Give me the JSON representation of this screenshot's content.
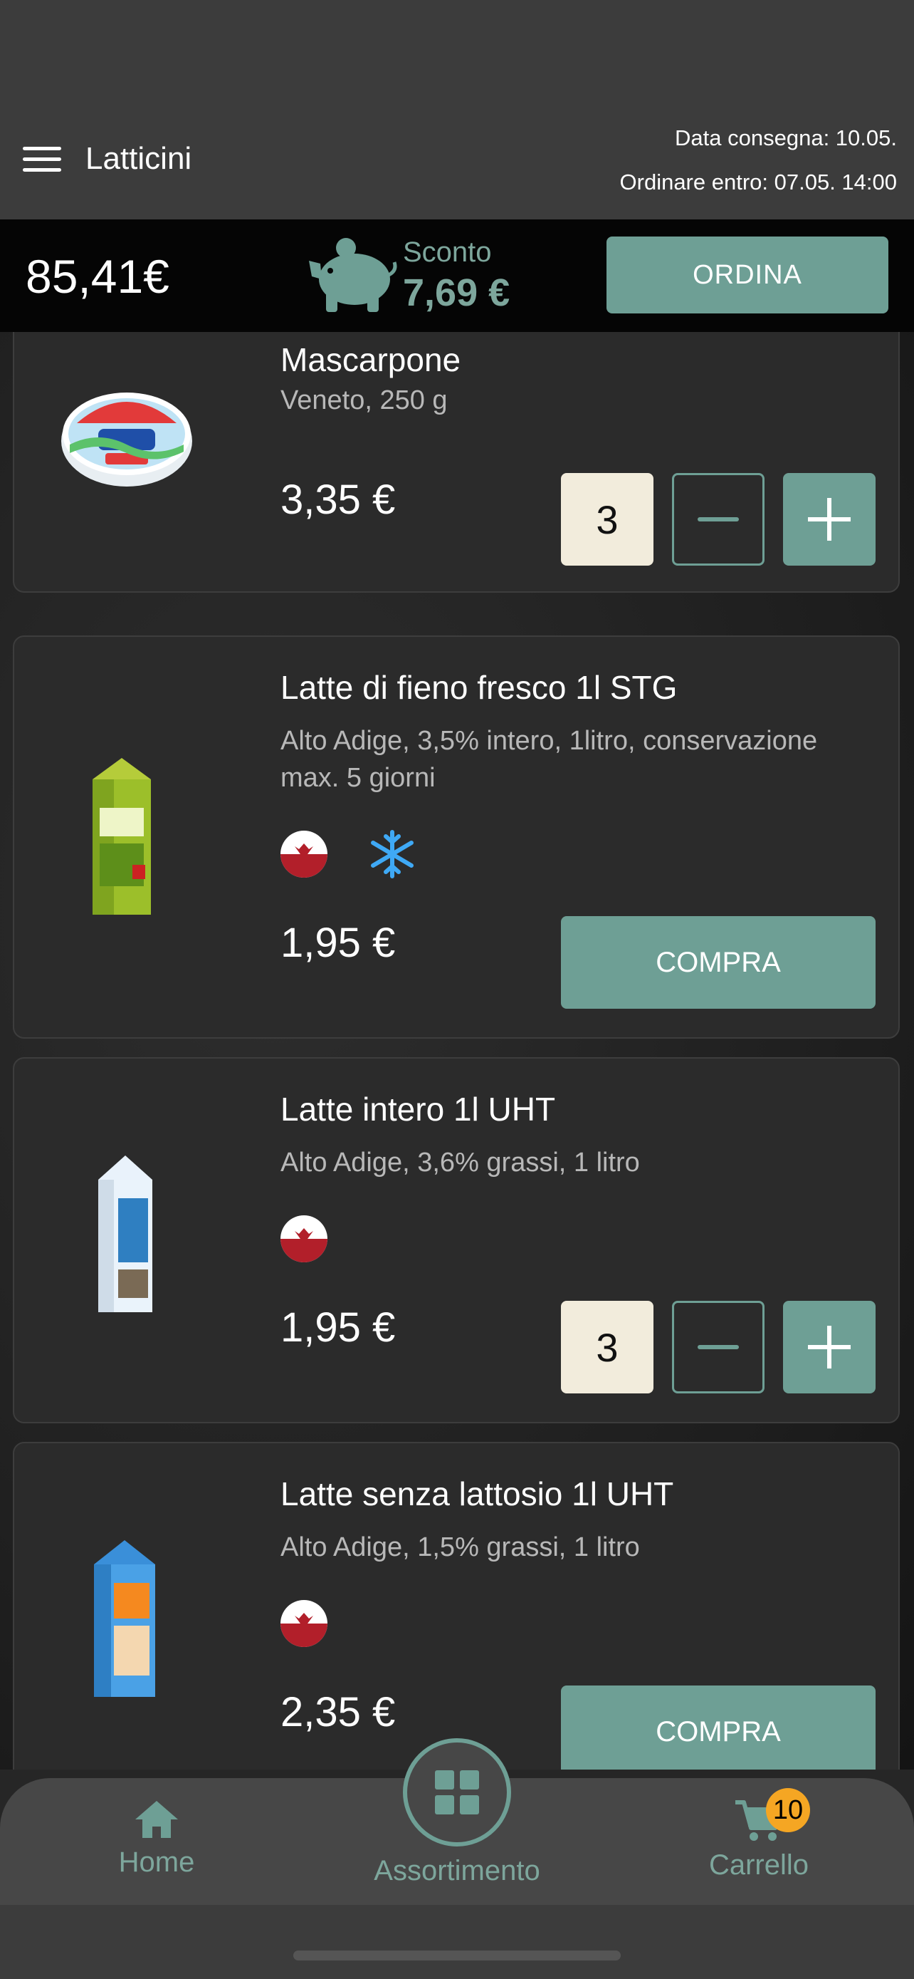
{
  "header": {
    "title": "Latticini",
    "delivery_date": "Data consegna: 10.05.",
    "order_by": "Ordinare entro: 07.05. 14:00"
  },
  "summary": {
    "total": "85,41€",
    "discount_label": "Sconto",
    "discount_value": "7,69 €",
    "order_label": "ORDINA"
  },
  "products": [
    {
      "name": "Mascarpone",
      "desc": "Veneto, 250 g",
      "price": "3,35 €",
      "quantity": "3"
    },
    {
      "name": "Latte di fieno fresco 1l STG",
      "desc": "Alto Adige, 3,5% intero, 1litro, conservazione max. 5 giorni",
      "price": "1,95 €",
      "buy_label": "COMPRA"
    },
    {
      "name": "Latte intero 1l UHT",
      "desc": "Alto Adige, 3,6% grassi, 1 litro",
      "price": "1,95 €",
      "quantity": "3"
    },
    {
      "name": "Latte senza lattosio 1l UHT",
      "desc": "Alto Adige, 1,5% grassi, 1 litro",
      "price": "2,35 €",
      "buy_label": "COMPRA"
    }
  ],
  "tabbar": {
    "home": "Home",
    "assortment": "Assortimento",
    "cart": "Carrello",
    "cart_count": "10"
  },
  "colors": {
    "accent": "#6e9f95",
    "header_bg": "#3c3c3c",
    "summary_bg": "#050505",
    "card_bg": "#2b2b2b",
    "qty_bg": "#f2ecdc",
    "badge": "#f5a623"
  },
  "icons": [
    "menu-icon",
    "piggy-bank-icon",
    "south-tyrol-eagle-icon",
    "snowflake-icon",
    "home-icon",
    "grid-icon",
    "cart-icon"
  ]
}
